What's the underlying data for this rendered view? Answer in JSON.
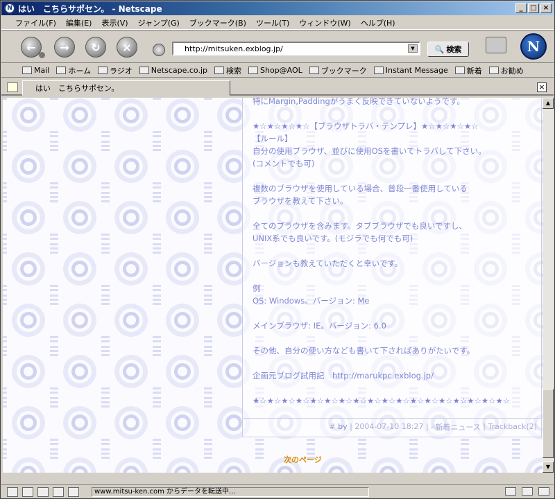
{
  "window": {
    "title": "はい　こちらサポセン。 - Netscape",
    "app_icon_glyph": "N"
  },
  "menu": [
    "ファイル(F)",
    "編集(E)",
    "表示(V)",
    "ジャンプ(G)",
    "ブックマーク(B)",
    "ツール(T)",
    "ウィンドウ(W)",
    "ヘルプ(H)"
  ],
  "navigation": {
    "url": "http://mitsuken.exblog.jp/",
    "search_label": "検索"
  },
  "personal_toolbar": [
    "Mail",
    "ホーム",
    "ラジオ",
    "Netscape.co.jp",
    "検索",
    "Shop@AOL",
    "ブックマーク",
    "Instant Message",
    "新着",
    "お勧め"
  ],
  "tab": {
    "label": "はい　こちらサポセン。"
  },
  "post": {
    "lines": [
      "特にMargin,Paddingがうまく反映できていないようです。",
      "",
      "★☆★☆★☆★☆【ブラウザトラバ・テンプレ】★☆★☆★☆★☆",
      "【ルール】",
      "自分の使用ブラウザ、並びに使用OSを書いてトラバして下さい。",
      "(コメントでも可)",
      "",
      "複数のブラウザを使用している場合、普段一番使用している",
      "ブラウザを教えて下さい。",
      "",
      "全てのブラウザを含みます。タブブラウザでも良いですし、",
      "UNIX系でも良いです。(モジラでも何でも可)",
      "",
      "バージョンも教えていただくと幸いです。",
      "",
      "例",
      "OS: Windows。バージョン: Me",
      "",
      "メインブラウザ: IE。バージョン: 6.0",
      "",
      "その他、自分の使い方なども書いて下さればありがたいです。",
      "",
      "企画元ブログ試用記　http://marukpc.exblog.jp/",
      "",
      "★☆★☆★☆★☆★☆★☆★☆★☆★☆★☆★☆★☆★☆★☆★☆★☆★☆★☆"
    ],
    "footer": {
      "hash": "#",
      "by": "by",
      "date": "2004-07-10 18:27",
      "category": "新着ニュース",
      "trackback": "Trackback(2)"
    }
  },
  "next_page": "次のページ",
  "status": {
    "text": "www.mitsu-ken.com からデータを転送中..."
  }
}
